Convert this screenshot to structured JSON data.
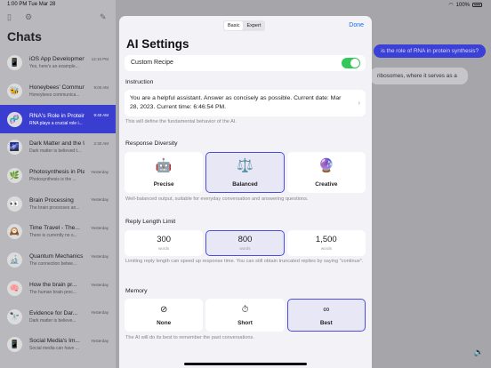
{
  "status_bar": {
    "time": "1:00 PM",
    "date": "Tue Mar 28",
    "battery": "100%"
  },
  "sidebar": {
    "title": "Chats",
    "chats": [
      {
        "title": "iOS App Development",
        "subtitle": "Yes, here's an example...",
        "time": "12:10 PM",
        "icon": "📱"
      },
      {
        "title": "Honeybees' Communication",
        "subtitle": "Honeybees communica...",
        "time": "9:00 AM",
        "icon": "🐝"
      },
      {
        "title": "RNA's Role in Protein Synthesis",
        "subtitle": "RNA plays a crucial role i...",
        "time": "9:40 AM",
        "icon": "🧬",
        "selected": true
      },
      {
        "title": "Dark Matter and the Universe",
        "subtitle": "Dark matter is believed t...",
        "time": "2:30 AM",
        "icon": "🌌"
      },
      {
        "title": "Photosynthesis in Plants",
        "subtitle": "Photosynthesis is the ...",
        "time": "Yesterday",
        "icon": "🌿"
      },
      {
        "title": "Brain Processing",
        "subtitle": "The brain processes an...",
        "time": "Yesterday",
        "icon": "👀"
      },
      {
        "title": "Time Travel - The...",
        "subtitle": "There is currently no s...",
        "time": "Yesterday",
        "icon": "🕰️"
      },
      {
        "title": "Quantum Mechanics",
        "subtitle": "The connection betwe...",
        "time": "Yesterday",
        "icon": "🔬"
      },
      {
        "title": "How the brain pr...",
        "subtitle": "The human brain proc...",
        "time": "Yesterday",
        "icon": "🧠"
      },
      {
        "title": "Evidence for Dar...",
        "subtitle": "Dark matter is believe...",
        "time": "Yesterday",
        "icon": "🔭"
      },
      {
        "title": "Social Media's Im...",
        "subtitle": "Social media can have ...",
        "time": "Yesterday",
        "icon": "📱"
      }
    ]
  },
  "chat": {
    "user_message": "is the role of RNA in protein synthesis?",
    "ai_message": "ribosomes, where it serves as a"
  },
  "modal": {
    "tabs": [
      "Basic",
      "Expert"
    ],
    "active_tab": "Basic",
    "done_label": "Done",
    "title": "AI Settings",
    "custom_recipe_label": "Custom Recipe",
    "custom_recipe_on": true,
    "instruction": {
      "section_title": "Instruction",
      "text": "You are a helpful assistant. Answer as concisely as possible. Current date: Mar 28, 2023. Current time: 6:46:54 PM.",
      "note": "This will define the fundamental behavior of the AI."
    },
    "diversity": {
      "section_title": "Response Diversity",
      "options": [
        {
          "label": "Precise",
          "icon": "robot-icon",
          "glyph": "🤖"
        },
        {
          "label": "Balanced",
          "icon": "scales-icon",
          "glyph": "⚖️",
          "selected": true
        },
        {
          "label": "Creative",
          "icon": "crystal-ball-icon",
          "glyph": "🔮"
        }
      ],
      "note": "Well-balanced output, suitable for everyday conversation and answering questions."
    },
    "length": {
      "section_title": "Reply Length Limit",
      "options": [
        {
          "value": "300",
          "unit": "words"
        },
        {
          "value": "800",
          "unit": "words",
          "selected": true
        },
        {
          "value": "1,500",
          "unit": "words"
        }
      ],
      "note": "Limiting reply length can speed up response time. You can still obtain truncated replies by saying \"continue\"."
    },
    "memory": {
      "section_title": "Memory",
      "options": [
        {
          "label": "None",
          "icon": "none-icon",
          "glyph": "⊘"
        },
        {
          "label": "Short",
          "icon": "stopwatch-icon",
          "glyph": "⏱"
        },
        {
          "label": "Best",
          "icon": "infinity-icon",
          "glyph": "∞",
          "selected": true
        }
      ],
      "note": "The AI will do its best to remember the past conversations."
    }
  }
}
